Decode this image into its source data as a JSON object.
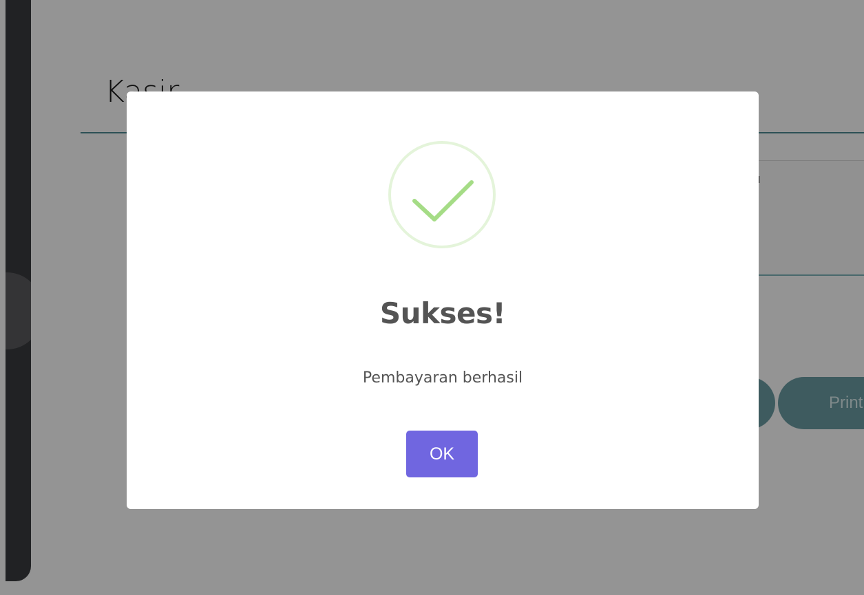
{
  "background": {
    "page_title": "Kasir",
    "print_button_label": "Print"
  },
  "dialog": {
    "icon": "success-check-icon",
    "title": "Sukses!",
    "message": "Pembayaran berhasil",
    "confirm_label": "OK"
  },
  "colors": {
    "confirm_button": "#7066e0",
    "success_icon": "#a5dc86",
    "accent": "#4f8c93",
    "overlay": "rgba(0,0,0,0.42)"
  }
}
